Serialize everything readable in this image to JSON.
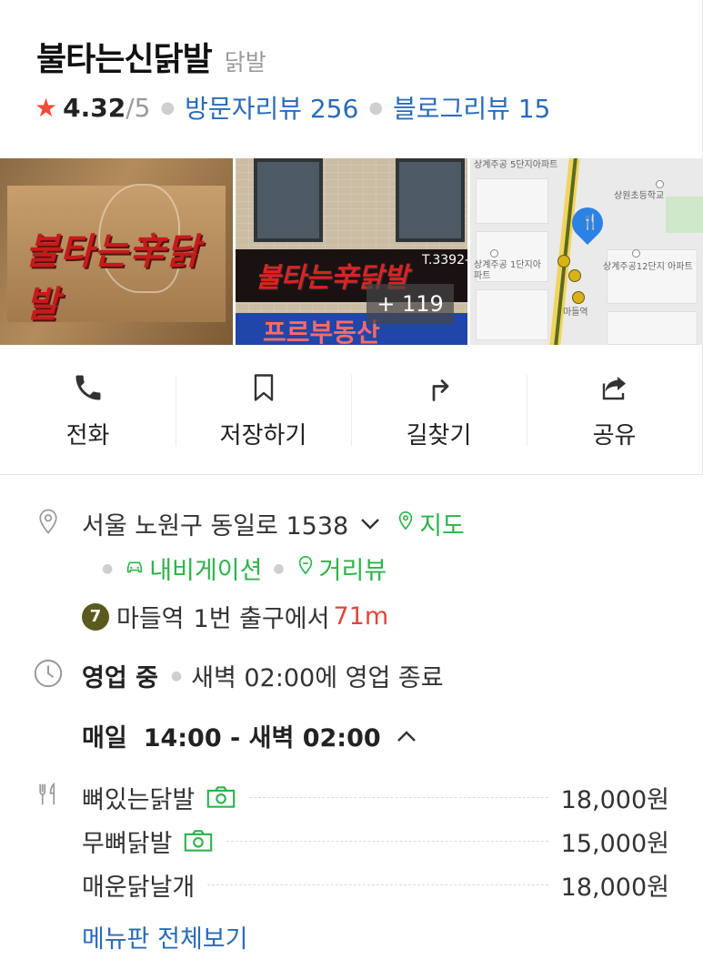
{
  "place": {
    "name": "불타는신닭발",
    "category": "닭발",
    "rating": {
      "score": "4.32",
      "max": "/5",
      "visitor_reviews_label": "방문자리뷰 256",
      "blog_reviews_label": "블로그리뷰 15"
    }
  },
  "photos": {
    "photo1_sign": "불타는辛닭발",
    "photo2_sign": "불타는辛닭발",
    "photo2_phone": "T.3392-",
    "photo2_bottom": "프르부동산",
    "more_count": "+ 119"
  },
  "map": {
    "labels": [
      "상계주공 5단지아파트",
      "상원초등학교",
      "상계주공 1단지아파트",
      "상계주공12단지 아파트",
      "마들역"
    ],
    "pin_color": "#2a82e4"
  },
  "actions": [
    {
      "label": "전화",
      "icon": "phone-icon"
    },
    {
      "label": "저장하기",
      "icon": "bookmark-icon"
    },
    {
      "label": "길찾기",
      "icon": "directions-icon"
    },
    {
      "label": "공유",
      "icon": "share-icon"
    }
  ],
  "address": {
    "text": "서울 노원구 동일로 1538",
    "map_link": "지도",
    "navigation_link": "내비게이션",
    "street_view_link": "거리뷰"
  },
  "subway": {
    "line_number": "7",
    "station": "마들역",
    "exit": "1번 출구에서",
    "distance": "71m",
    "line_color": "#5a5a1e"
  },
  "hours": {
    "status": "영업 중",
    "closing_note": "새벽 02:00에 영업 종료",
    "day": "매일",
    "time_range": "14:00 - 새벽 02:00"
  },
  "menu": {
    "items": [
      {
        "name": "뼈있는닭발",
        "has_photo": true,
        "price": "18,000원"
      },
      {
        "name": "무뼈닭발",
        "has_photo": true,
        "price": "15,000원"
      },
      {
        "name": "매운닭날개",
        "has_photo": false,
        "price": "18,000원"
      }
    ],
    "view_all": "메뉴판 전체보기"
  },
  "colors": {
    "link_blue": "#2b6bb8",
    "green": "#2db44b",
    "star_red": "#f04a3a",
    "distance_red": "#e2463b"
  }
}
